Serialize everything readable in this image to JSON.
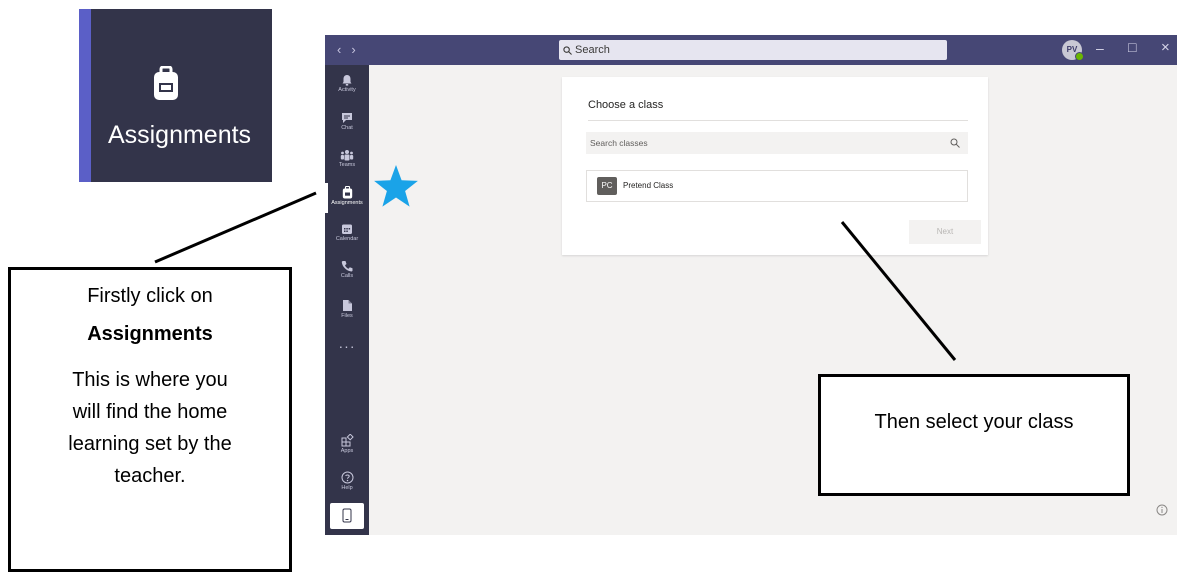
{
  "zoom_inset": {
    "label": "Assignments",
    "icon": "backpack-icon"
  },
  "titlebar": {
    "back": "‹",
    "forward": "›",
    "search_placeholder": "Search",
    "avatar_initials": "PV",
    "minimize": "–",
    "maximize": "□",
    "close": "×"
  },
  "rail": {
    "items": [
      {
        "label": "Activity",
        "icon": "bell-icon"
      },
      {
        "label": "Chat",
        "icon": "chat-icon"
      },
      {
        "label": "Teams",
        "icon": "teams-icon"
      },
      {
        "label": "Assignments",
        "icon": "backpack-icon",
        "active": true
      },
      {
        "label": "Calendar",
        "icon": "calendar-icon"
      },
      {
        "label": "Calls",
        "icon": "phone-icon"
      },
      {
        "label": "Files",
        "icon": "file-icon"
      }
    ],
    "more": "···",
    "bottom_items": [
      {
        "label": "Apps",
        "icon": "apps-icon"
      },
      {
        "label": "Help",
        "icon": "help-icon"
      }
    ]
  },
  "dialog": {
    "title": "Choose a class",
    "search_placeholder": "Search classes",
    "classes": [
      {
        "initials": "PC",
        "name": "Pretend Class"
      }
    ],
    "next_label": "Next"
  },
  "annotations": {
    "left_line1": "Firstly click on",
    "left_line2": "Assignments",
    "left_line3": "This is where you",
    "left_line4": "will find the home",
    "left_line5": "learning set by the",
    "left_line6": "teacher.",
    "right_text": "Then select your class",
    "star_color": "#1aa3e8"
  },
  "colors": {
    "titlebar": "#464775",
    "rail": "#33344a",
    "canvas": "#f3f2f1"
  }
}
